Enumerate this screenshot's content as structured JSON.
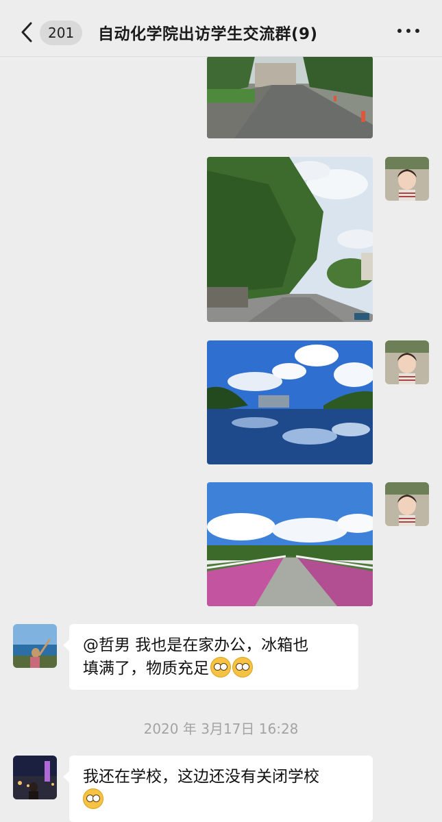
{
  "header": {
    "back_count": "201",
    "title": "自动化学院出访学生交流群(9)"
  },
  "messages": {
    "text1": "@哲男 我也是在家办公，冰箱也填满了，物质充足",
    "text1_line1": "@哲男 我也是在家办公，冰箱也",
    "text1_line2": "填满了，物质充足",
    "timestamp": "2020 年 3月17日 16:28",
    "text2_line1": "我还在学校，这边还没有关闭学校",
    "text2": "我还在学校，这边还没有关闭学校"
  },
  "icons": {
    "back": "chevron-left-icon",
    "more": "more-dots-icon",
    "emoji_flushed": "flushed-face-emoji",
    "emoji_monocle": "face-with-monocle-emoji"
  },
  "colors": {
    "background": "#ededed",
    "bubble": "#ffffff",
    "timestamp": "#a3a3a3"
  }
}
